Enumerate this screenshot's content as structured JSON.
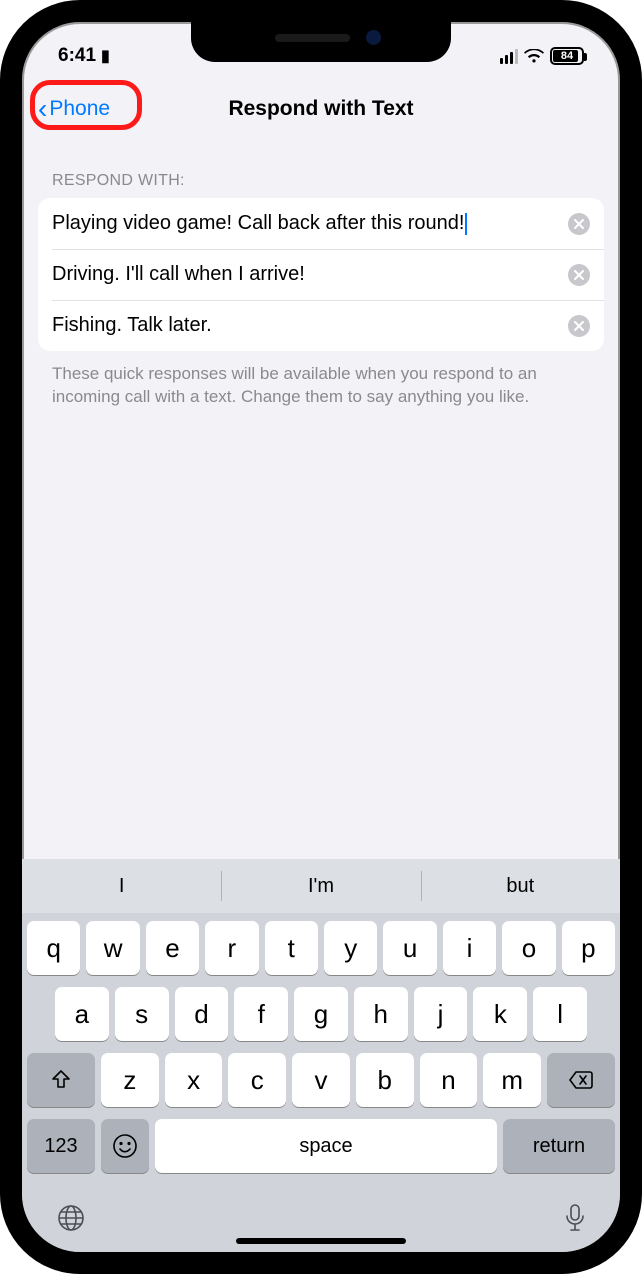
{
  "status": {
    "time": "6:41",
    "lock_glyph": "▮",
    "battery": "84"
  },
  "nav": {
    "back_label": "Phone",
    "title": "Respond with Text"
  },
  "section": {
    "header": "Respond with:",
    "items": [
      "Playing video game! Call back after this round!",
      "Driving. I'll call when I arrive!",
      "Fishing. Talk later."
    ],
    "footer": "These quick responses will be available when you respond to an incoming call with a text. Change them to say anything you like."
  },
  "keyboard": {
    "suggestions": [
      "I",
      "I'm",
      "but"
    ],
    "row1": [
      "q",
      "w",
      "e",
      "r",
      "t",
      "y",
      "u",
      "i",
      "o",
      "p"
    ],
    "row2": [
      "a",
      "s",
      "d",
      "f",
      "g",
      "h",
      "j",
      "k",
      "l"
    ],
    "row3": [
      "z",
      "x",
      "c",
      "v",
      "b",
      "n",
      "m"
    ],
    "numeric_label": "123",
    "space_label": "space",
    "return_label": "return"
  }
}
